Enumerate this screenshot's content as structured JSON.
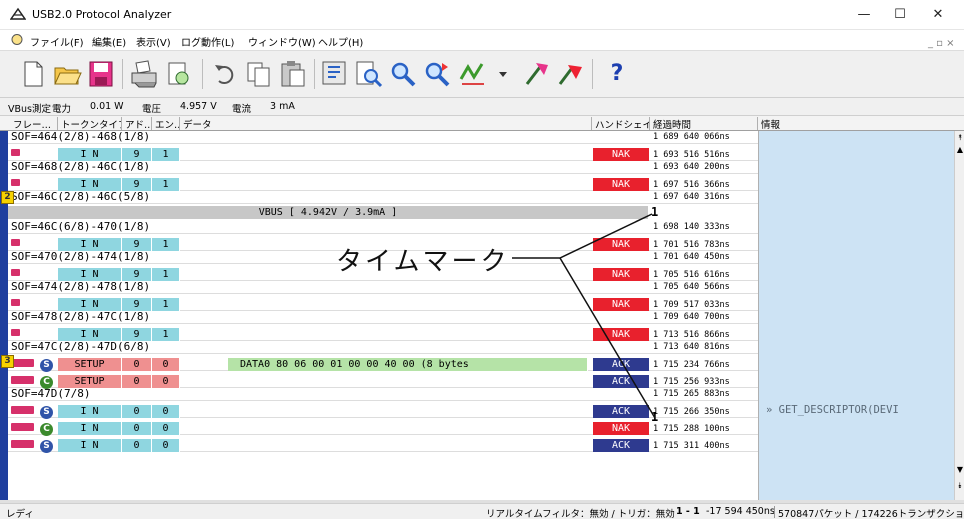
{
  "window": {
    "title": "USB2.0 Protocol Analyzer",
    "minimize": "—",
    "maximize": "☐",
    "close": "✕",
    "mdi_controls": "_ ▫ ×"
  },
  "menu": [
    "ファイル(F)",
    "編集(E)",
    "表示(V)",
    "ログ動作(L)",
    "ウィンドウ(W)",
    "ヘルプ(H)"
  ],
  "toolbar": {
    "help_glyph": "?",
    "icons": [
      "new-file-icon",
      "open-folder-icon",
      "save-icon",
      "print-icon",
      "print-preview-icon",
      "undo-icon",
      "copy-icon",
      "paste-icon",
      "filter-icon",
      "search-icon",
      "find-icon",
      "find-next-icon",
      "trigger-icon",
      "dropdown-icon",
      "marker-icon",
      "marker2-icon",
      "help-icon"
    ]
  },
  "vbus_strip": {
    "label": "VBus測定",
    "power_label": "電力",
    "power_value": "0.01 W",
    "voltage_label": "電圧",
    "voltage_value": "4.957 V",
    "current_label": "電流",
    "current_value": "3 mA"
  },
  "columns": [
    "フレー…",
    "トークンタイプ",
    "アド…",
    "エン…",
    "データ",
    "ハンドシェイ…",
    "経過時間",
    "情報"
  ],
  "rows": [
    {
      "type": "sof",
      "text": "SOF=464(2/8)-468(1/8)",
      "time": "1 689 640 066ns"
    },
    {
      "type": "tk",
      "token": "I N",
      "addr": "9",
      "ep": "1",
      "hs": "NAK",
      "time": "1 693 516 516ns"
    },
    {
      "type": "sof",
      "text": "SOF=468(2/8)-46C(1/8)",
      "time": "1 693 640 200ns"
    },
    {
      "type": "tk",
      "token": "I N",
      "addr": "9",
      "ep": "1",
      "hs": "NAK",
      "time": "1 697 516 366ns"
    },
    {
      "type": "sof",
      "text": "SOF=46C(2/8)-46C(5/8)",
      "time": "1 697 640 316ns",
      "marker": "2"
    },
    {
      "type": "vbus",
      "text": "VBUS [ 4.942V / 3.9mA ]"
    },
    {
      "type": "sof",
      "text": "SOF=46C(6/8)-470(1/8)",
      "time": "1 698 140 333ns"
    },
    {
      "type": "tk",
      "token": "I N",
      "addr": "9",
      "ep": "1",
      "hs": "NAK",
      "time": "1 701 516 783ns"
    },
    {
      "type": "sof",
      "text": "SOF=470(2/8)-474(1/8)",
      "time": "1 701 640 450ns"
    },
    {
      "type": "tk",
      "token": "I N",
      "addr": "9",
      "ep": "1",
      "hs": "NAK",
      "time": "1 705 516 616ns"
    },
    {
      "type": "sof",
      "text": "SOF=474(2/8)-478(1/8)",
      "time": "1 705 640 566ns"
    },
    {
      "type": "tk",
      "token": "I N",
      "addr": "9",
      "ep": "1",
      "hs": "NAK",
      "time": "1 709 517 033ns"
    },
    {
      "type": "sof",
      "text": "SOF=478(2/8)-47C(1/8)",
      "time": "1 709 640 700ns"
    },
    {
      "type": "tk",
      "token": "I N",
      "addr": "9",
      "ep": "1",
      "hs": "NAK",
      "time": "1 713 516 866ns"
    },
    {
      "type": "sof",
      "text": "SOF=47C(2/8)-47D(6/8)",
      "time": "1 713 640 816ns"
    },
    {
      "type": "setup",
      "token": "SETUP",
      "addr": "0",
      "ep": "0",
      "data": "DATA0 80 06 00 01 00 00 40 00 (8 bytes",
      "hs": "ACK",
      "time": "1 715 234 766ns",
      "marker": "3",
      "pid": "S",
      "info": "GET_DESCRIPTOR(DEVI"
    },
    {
      "type": "setup2",
      "token": "SETUP",
      "addr": "0",
      "ep": "0",
      "hs": "ACK",
      "time": "1 715 256 933ns",
      "pid": "C"
    },
    {
      "type": "sof",
      "text": "SOF=47D(7/8)",
      "time": "1 715 265 883ns"
    },
    {
      "type": "tkfs",
      "token": "I N",
      "addr": "0",
      "ep": "0",
      "hs": "ACK",
      "time": "1 715 266 350ns",
      "pid": "S"
    },
    {
      "type": "tkfs",
      "token": "I N",
      "addr": "0",
      "ep": "0",
      "hs": "NAK",
      "time": "1 715 288 100ns",
      "pid": "C"
    },
    {
      "type": "tkfs",
      "token": "I N",
      "addr": "0",
      "ep": "0",
      "hs": "ACK",
      "time": "1 715 311 400ns",
      "pid": "S"
    }
  ],
  "annotation": "タイムマーク",
  "timemark_glyph": "1",
  "info_arrow": "»",
  "status": {
    "ready": "レディ",
    "filter": "リアルタイムフィルタ：無効 / トリガ：無効",
    "marker": "1 - 1",
    "delta": "-17 594 450ns",
    "packets": "570847パケット / 174226トランザクション"
  },
  "colors": {
    "nak": "#e8212d",
    "ack": "#2e3a8f",
    "token": "#8fd6e0",
    "setup": "#ef9090",
    "data": "#b5e3a7",
    "info_bg": "#cde3f4",
    "gutter": "#1f3f9e"
  }
}
